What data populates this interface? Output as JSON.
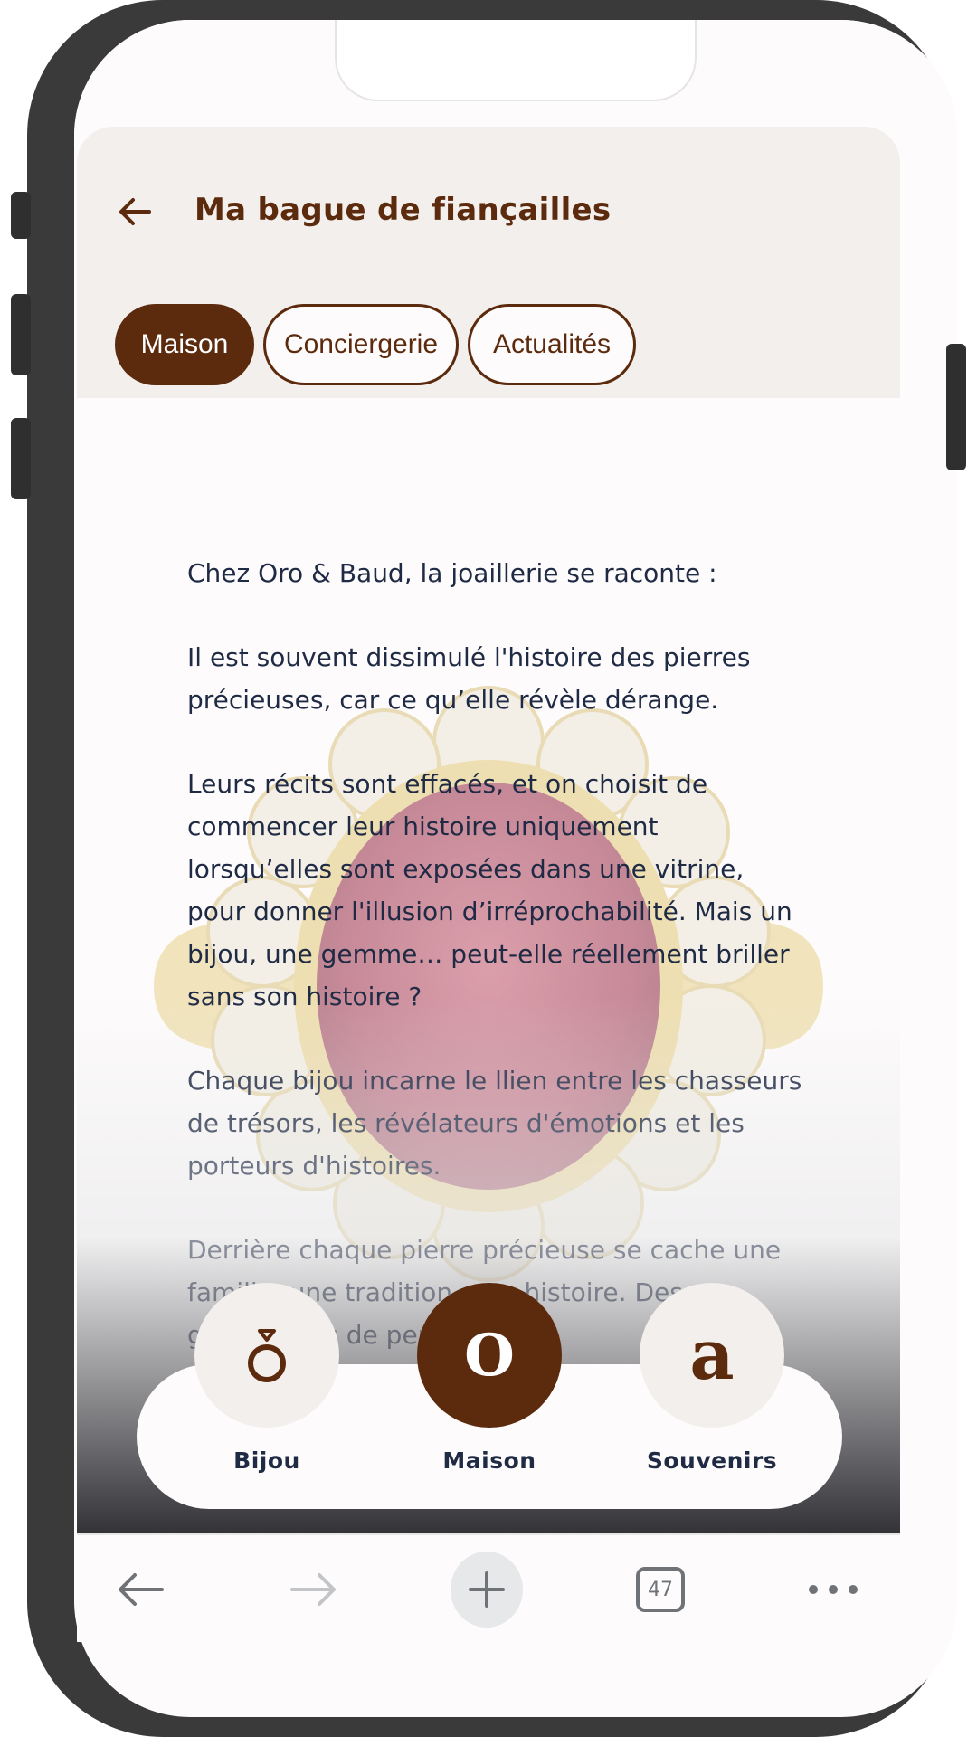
{
  "header": {
    "title": "Ma bague de fiançailles"
  },
  "tabs": [
    {
      "label": "Maison",
      "active": true
    },
    {
      "label": "Conciergerie",
      "active": false
    },
    {
      "label": "Actualités",
      "active": false
    }
  ],
  "content": {
    "paragraphs": [
      "Chez Oro & Baud, la joaillerie se raconte :",
      "Il est souvent dissimulé l'histoire des pierres précieuses, car ce qu’elle révèle dérange.",
      "Leurs récits sont effacés, et on choisit de commencer leur histoire uniquement lorsqu’elles sont exposées dans une vitrine, pour donner l'illusion d’irréprochabilité. Mais un bijou, une gemme… peut-elle réellement briller sans son histoire ?",
      "Chaque bijou incarne le llien entre les chasseurs de trésors, les révélateurs d'émotions et les porteurs d'histoires.",
      "Derrière chaque pierre précieuse se cache une famille, une tradition, une histoire. Des générations de personnes et"
    ]
  },
  "bottom_nav": {
    "items": [
      {
        "label": "Bijou",
        "icon": "ring-icon",
        "active": false
      },
      {
        "label": "Maison",
        "icon": "o-monogram-icon",
        "glyph": "O",
        "active": true
      },
      {
        "label": "Souvenirs",
        "icon": "a-monogram-icon",
        "glyph": "a",
        "active": false
      }
    ]
  },
  "browser_toolbar": {
    "tab_count": "47",
    "items": [
      "back-icon",
      "forward-icon",
      "new-tab-icon",
      "tabs-icon",
      "more-icon"
    ]
  },
  "colors": {
    "brand": "#5c2a0d",
    "header_bg": "#f2efec",
    "text": "#1f2a44"
  }
}
